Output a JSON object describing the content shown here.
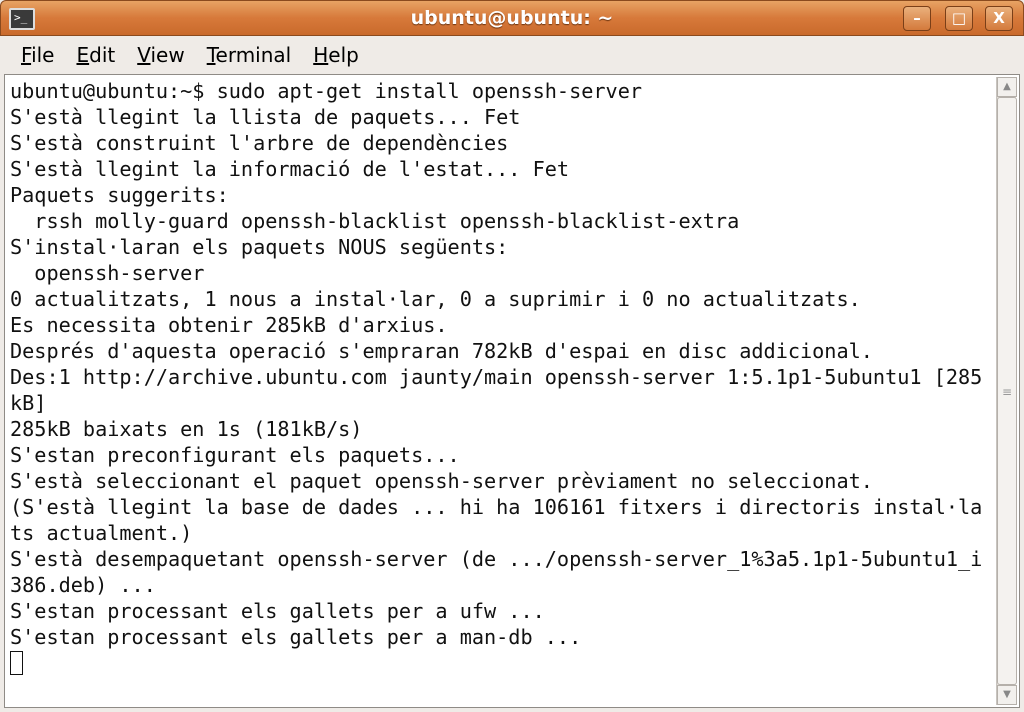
{
  "window": {
    "title": "ubuntu@ubuntu: ~"
  },
  "menu": [
    {
      "label": "File",
      "key": "F",
      "rest": "ile"
    },
    {
      "label": "Edit",
      "key": "E",
      "rest": "dit"
    },
    {
      "label": "View",
      "key": "V",
      "rest": "iew"
    },
    {
      "label": "Terminal",
      "key": "T",
      "rest": "erminal"
    },
    {
      "label": "Help",
      "key": "H",
      "rest": "elp"
    }
  ],
  "terminal": {
    "lines": [
      "ubuntu@ubuntu:~$ sudo apt-get install openssh-server",
      "S'està llegint la llista de paquets... Fet",
      "S'està construint l'arbre de dependències",
      "S'està llegint la informació de l'estat... Fet",
      "Paquets suggerits:",
      "  rssh molly-guard openssh-blacklist openssh-blacklist-extra",
      "S'instal·laran els paquets NOUS següents:",
      "  openssh-server",
      "0 actualitzats, 1 nous a instal·lar, 0 a suprimir i 0 no actualitzats.",
      "Es necessita obtenir 285kB d'arxius.",
      "Després d'aquesta operació s'empraran 782kB d'espai en disc addicional.",
      "Des:1 http://archive.ubuntu.com jaunty/main openssh-server 1:5.1p1-5ubuntu1 [285",
      "kB]",
      "285kB baixats en 1s (181kB/s)",
      "S'estan preconfigurant els paquets...",
      "S'està seleccionant el paquet openssh-server prèviament no seleccionat.",
      "(S'està llegint la base de dades ... hi ha 106161 fitxers i directoris instal·la",
      "ts actualment.)",
      "S'està desempaquetant openssh-server (de .../openssh-server_1%3a5.1p1-5ubuntu1_i",
      "386.deb) ...",
      "S'estan processant els gallets per a ufw ...",
      "S'estan processant els gallets per a man-db ..."
    ]
  }
}
